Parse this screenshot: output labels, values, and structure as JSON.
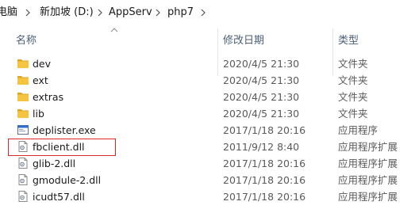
{
  "address_bar": {
    "crumbs": [
      "电脑",
      "新加坡 (D:)",
      "AppServ",
      "php7"
    ]
  },
  "columns": {
    "name": "名称",
    "date": "修改日期",
    "type": "类型"
  },
  "files": [
    {
      "name": "dev",
      "date": "2020/4/5 21:30",
      "type": "文件夹",
      "icon": "folder-icon"
    },
    {
      "name": "ext",
      "date": "2020/4/5 21:30",
      "type": "文件夹",
      "icon": "folder-icon"
    },
    {
      "name": "extras",
      "date": "2020/4/5 21:30",
      "type": "文件夹",
      "icon": "folder-icon"
    },
    {
      "name": "lib",
      "date": "2020/4/5 21:30",
      "type": "文件夹",
      "icon": "folder-icon"
    },
    {
      "name": "deplister.exe",
      "date": "2017/1/18 20:16",
      "type": "应用程序",
      "icon": "exe-icon"
    },
    {
      "name": "fbclient.dll",
      "date": "2011/9/12 8:40",
      "type": "应用程序扩展",
      "icon": "dll-icon"
    },
    {
      "name": "glib-2.dll",
      "date": "2017/1/18 20:16",
      "type": "应用程序扩展",
      "icon": "dll-icon"
    },
    {
      "name": "gmodule-2.dll",
      "date": "2017/1/18 20:16",
      "type": "应用程序扩展",
      "icon": "dll-icon"
    },
    {
      "name": "icudt57.dll",
      "date": "2017/1/18 20:16",
      "type": "应用程序扩展",
      "icon": "dll-icon"
    }
  ],
  "colors": {
    "folder": "#f5c542",
    "folder_dark": "#dca624",
    "highlight_box": "#e02626",
    "header_text": "#4c607a"
  }
}
